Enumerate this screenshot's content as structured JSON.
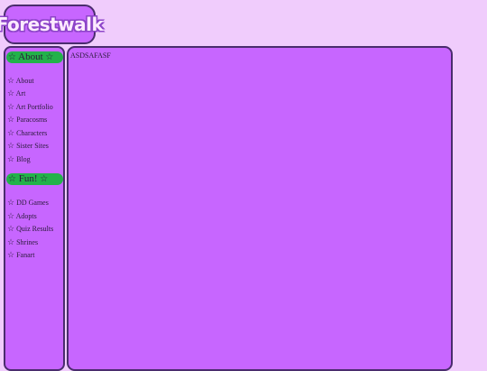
{
  "logo": {
    "text": "Forestwalk"
  },
  "sidebar": {
    "sections": [
      {
        "title": "About",
        "items": [
          "About",
          "Art",
          "Art Portfolio",
          "Paracosms",
          "Characters",
          "Sister Sites",
          "Blog"
        ]
      },
      {
        "title": "Fun!",
        "items": [
          "DD Games",
          "Adopts",
          "Quiz Results",
          "Shrines",
          "Fanart"
        ]
      }
    ],
    "star_glyph": "☆"
  },
  "main": {
    "text": "ASDSAFASF"
  },
  "colors": {
    "background": "#f0ccfc",
    "panel": "#c766ff",
    "border": "#4a2c6e",
    "header": "#23b24a"
  }
}
